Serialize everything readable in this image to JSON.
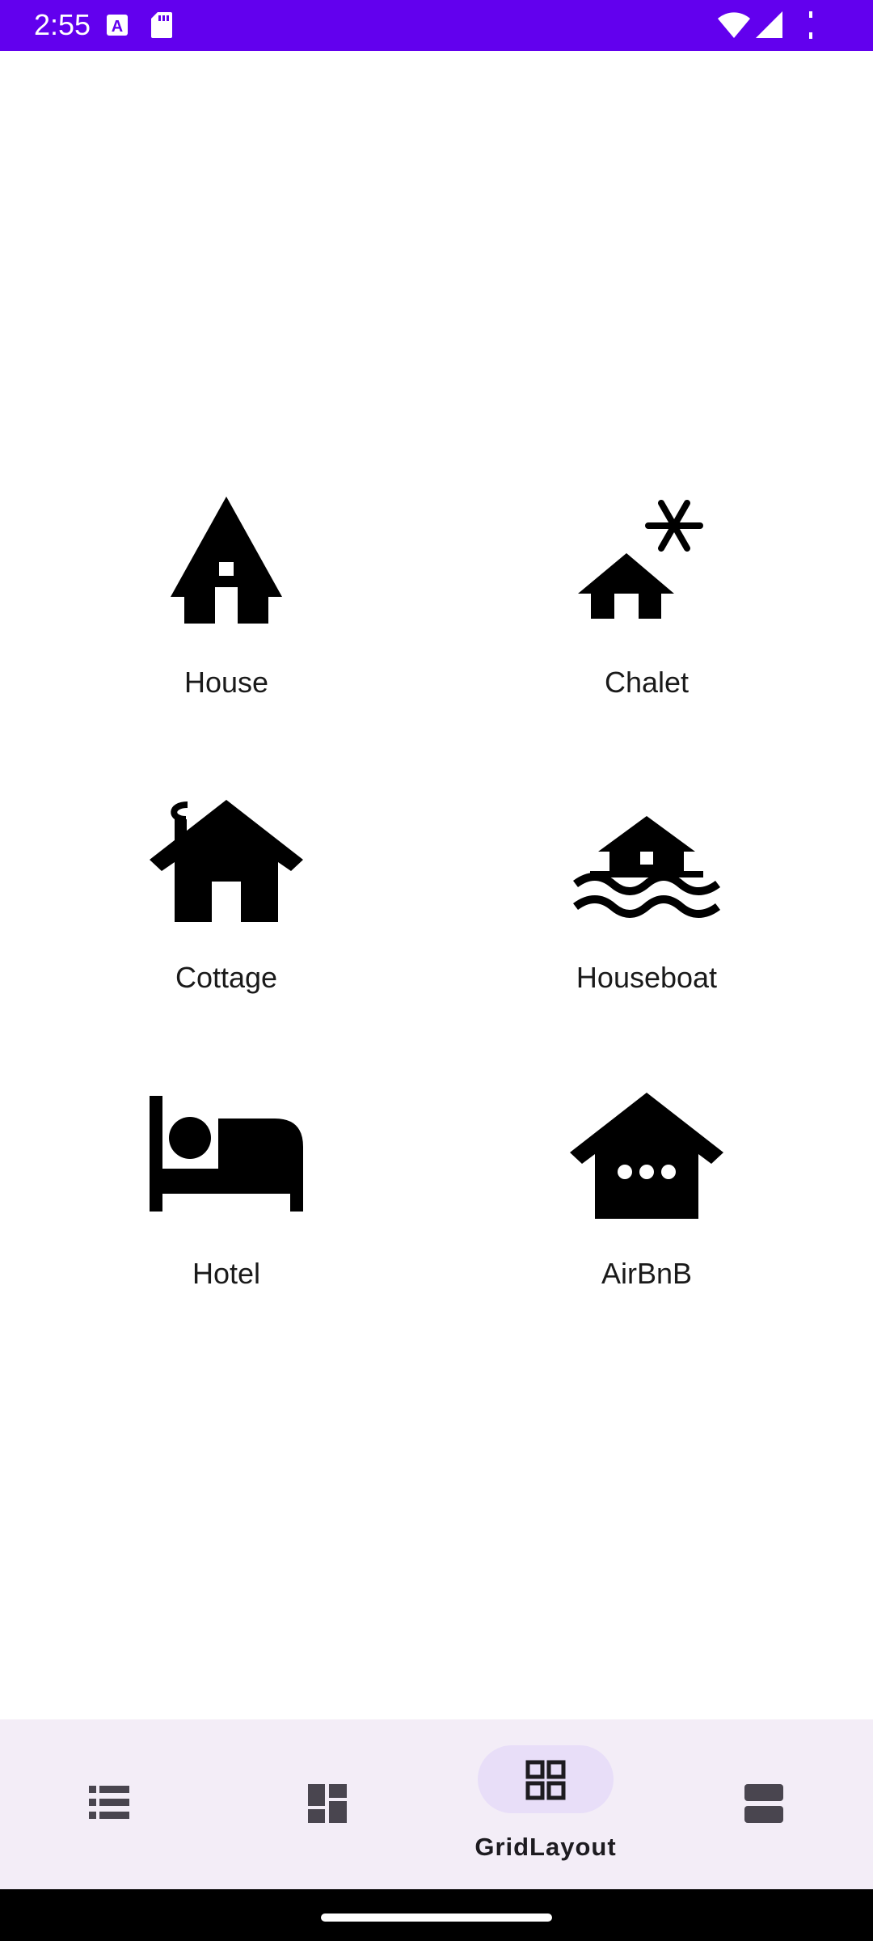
{
  "status_bar": {
    "time": "2:55",
    "background_color": "#6200ee",
    "icons": [
      "a-notification-icon",
      "sd-card-icon",
      "wifi-icon",
      "cell-signal-icon",
      "battery-icon"
    ]
  },
  "grid": {
    "items": [
      {
        "label": "House",
        "icon": "house-icon"
      },
      {
        "label": "Chalet",
        "icon": "chalet-icon"
      },
      {
        "label": "Cottage",
        "icon": "cottage-icon"
      },
      {
        "label": "Houseboat",
        "icon": "houseboat-icon"
      },
      {
        "label": "Hotel",
        "icon": "hotel-icon"
      },
      {
        "label": "AirBnB",
        "icon": "airbnb-icon"
      }
    ]
  },
  "bottom_nav": {
    "background_color": "#f3edf7",
    "active_pill_color": "#e8def8",
    "items": [
      {
        "icon": "list-icon",
        "label": "",
        "selected": false
      },
      {
        "icon": "dashboard-icon",
        "label": "",
        "selected": false
      },
      {
        "icon": "grid-icon",
        "label": "GridLayout",
        "selected": true
      },
      {
        "icon": "view-agenda-icon",
        "label": "",
        "selected": false
      }
    ]
  }
}
